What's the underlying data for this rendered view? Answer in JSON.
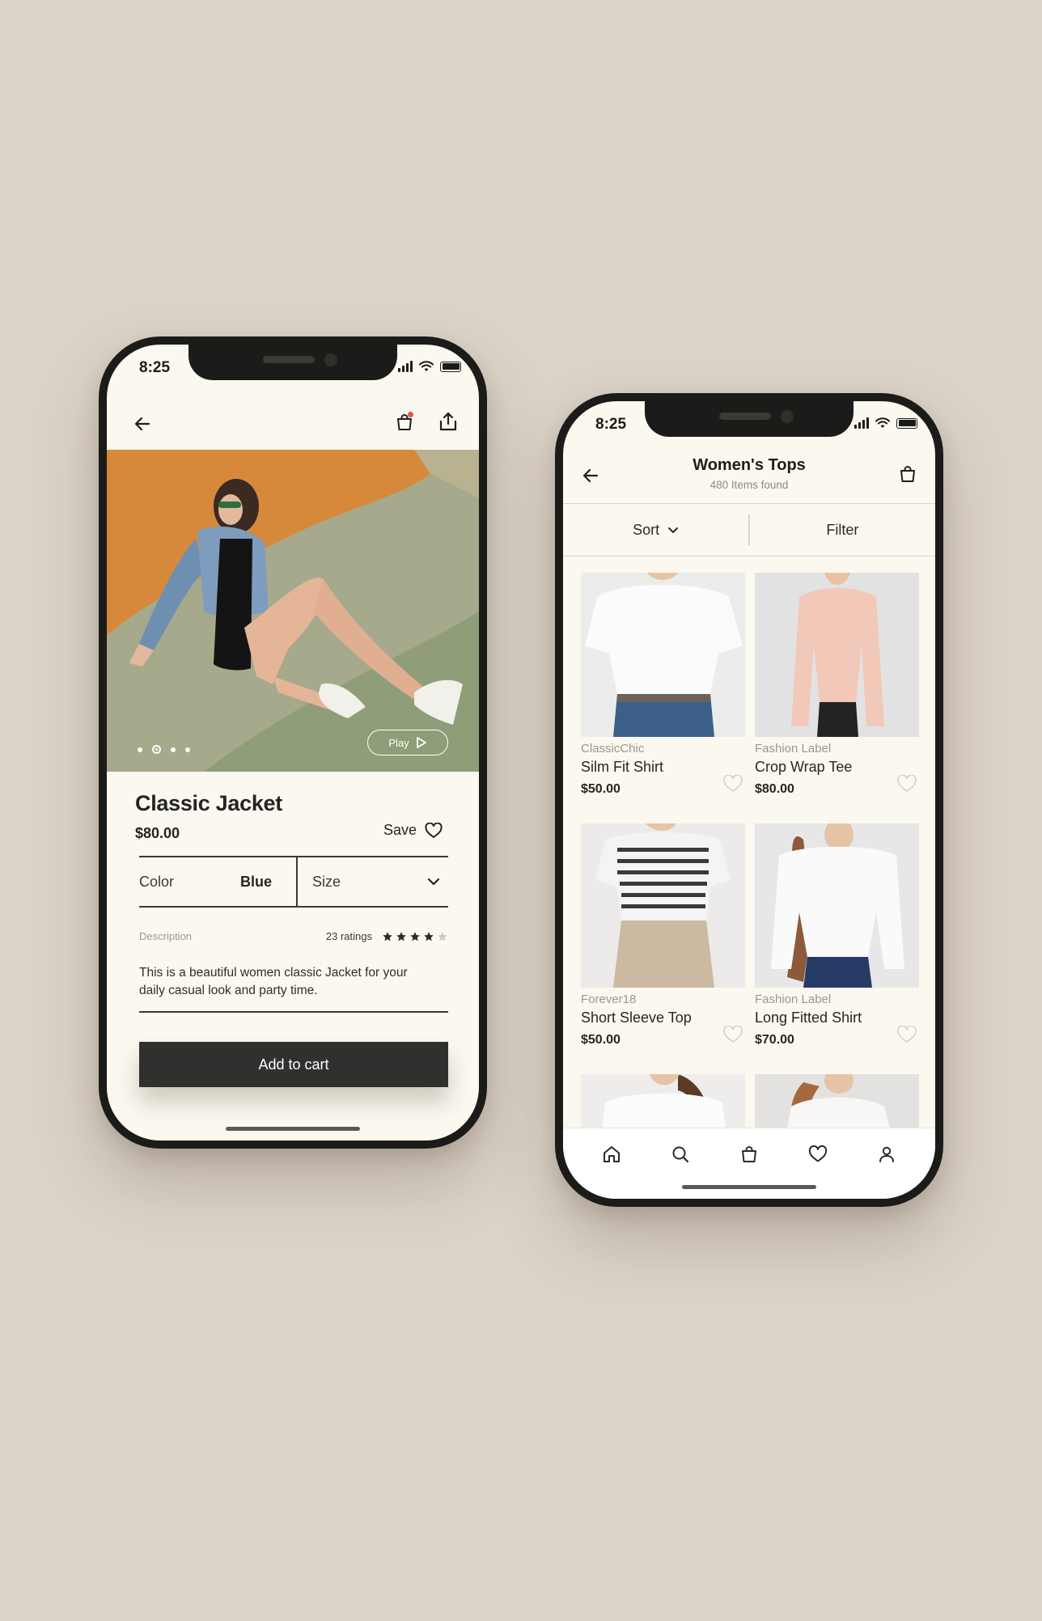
{
  "product_detail": {
    "status_time": "8:25",
    "title": "Classic Jacket",
    "price": "$80.00",
    "save_label": "Save",
    "color_label": "Color",
    "color_value": "Blue",
    "size_label": "Size",
    "description_label": "Description",
    "ratings_text": "23 ratings",
    "rating_value": 4,
    "rating_max": 5,
    "description": "This is a beautiful women classic Jacket for your daily casual look and party time.",
    "play_label": "Play",
    "carousel": {
      "count": 4,
      "active_index": 1
    },
    "add_to_cart_label": "Add to cart",
    "cart_badge_color": "#e9563d"
  },
  "category_list": {
    "status_time": "8:25",
    "title": "Women's Tops",
    "subtitle": "480 Items found",
    "sort_label": "Sort",
    "filter_label": "Filter",
    "products": [
      {
        "brand": "ClassicChic",
        "name": "Silm Fit Shirt",
        "price": "$50.00"
      },
      {
        "brand": "Fashion Label",
        "name": "Crop Wrap Tee",
        "price": "$80.00"
      },
      {
        "brand": "Forever18",
        "name": "Short Sleeve Top",
        "price": "$50.00"
      },
      {
        "brand": "Fashion Label",
        "name": "Long Fitted Shirt",
        "price": "$70.00"
      }
    ],
    "tabs": [
      "home-icon",
      "search-icon",
      "bag-icon",
      "heart-icon",
      "user-icon"
    ]
  },
  "colors": {
    "background": "#dcd3c8",
    "screen": "#fbf8ef",
    "dark_button": "#30302e",
    "frame": "#1b1b19"
  }
}
